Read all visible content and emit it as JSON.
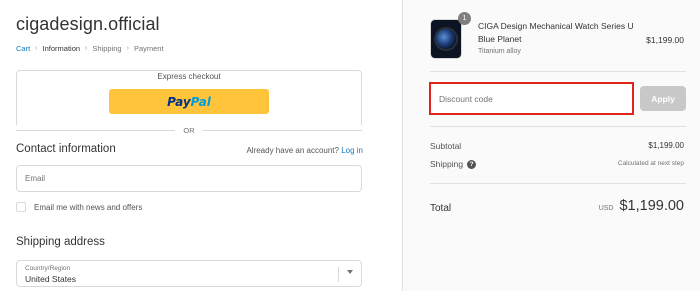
{
  "store": {
    "name": "cigadesign.official"
  },
  "breadcrumb": {
    "items": [
      {
        "label": "Cart"
      },
      {
        "label": "Information"
      },
      {
        "label": "Shipping"
      },
      {
        "label": "Payment"
      }
    ]
  },
  "express": {
    "title": "Express checkout",
    "paypal_part1": "Pay",
    "paypal_part2": "Pal",
    "or_text": "OR"
  },
  "contact": {
    "title": "Contact information",
    "login_prompt": "Already have an account?",
    "login_link": "Log in",
    "email_placeholder": "Email",
    "newsletter_label": "Email me with news and offers"
  },
  "shipping_address": {
    "title": "Shipping address",
    "country_label": "Country/Region",
    "country_value": "United States"
  },
  "order": {
    "product": {
      "name": "CIGA Design Mechanical Watch Series U Blue Planet",
      "variant": "Titanium alloy",
      "price": "$1,199.00",
      "quantity": "1"
    },
    "discount_placeholder": "Discount code",
    "apply_label": "Apply",
    "subtotal_label": "Subtotal",
    "subtotal_value": "$1,199.00",
    "shipping_label": "Shipping",
    "shipping_value": "Calculated at next step",
    "total_label": "Total",
    "currency": "USD",
    "total_value": "$1,199.00"
  },
  "colors": {
    "accent_link": "#197bbd",
    "paypal_yellow": "#ffc439",
    "highlight_border": "#e2231a"
  }
}
